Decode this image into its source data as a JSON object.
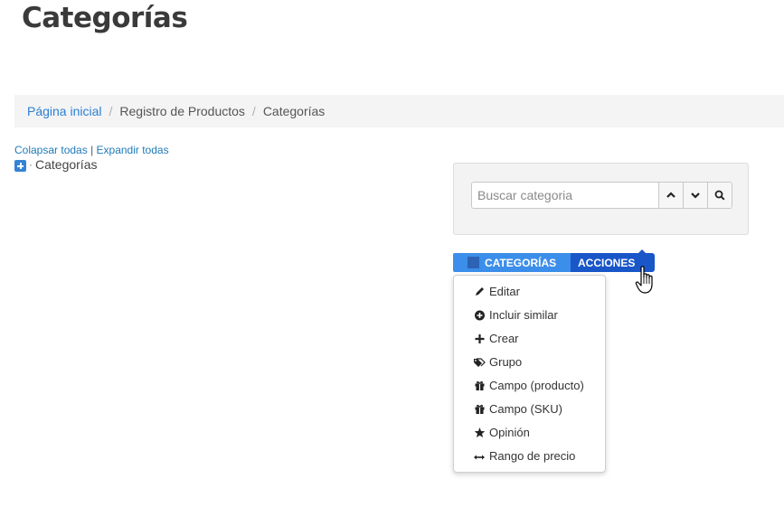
{
  "page": {
    "title": "Categorías"
  },
  "breadcrumb": {
    "home": "Página inicial",
    "separator": "/",
    "level1": "Registro de Productos",
    "current": "Categorías"
  },
  "tree": {
    "collapse_all": "Colapsar todas",
    "divider": "|",
    "expand_all": "Expandir todas",
    "root_label": "Categorías",
    "root_icon": "expand-plus-icon"
  },
  "search": {
    "placeholder": "Buscar categoria",
    "value": "",
    "prev_icon": "chevron-up-icon",
    "next_icon": "chevron-down-icon",
    "search_icon": "search-icon"
  },
  "tabs": {
    "categorias": "CATEGORÍAS",
    "acciones": "ACCIONES"
  },
  "actions_menu": {
    "items": [
      {
        "label": "Editar",
        "icon": "pencil-icon"
      },
      {
        "label": "Incluir similar",
        "icon": "plus-circle-icon"
      },
      {
        "label": "Crear",
        "icon": "plus-icon"
      },
      {
        "label": "Grupo",
        "icon": "tags-icon"
      },
      {
        "label": "Campo (producto)",
        "icon": "gift-icon"
      },
      {
        "label": "Campo (SKU)",
        "icon": "gift-icon"
      },
      {
        "label": "Opinión",
        "icon": "star-icon"
      },
      {
        "label": "Rango de precio",
        "icon": "arrows-horizontal-icon"
      }
    ]
  },
  "colors": {
    "link": "#2b7fd3",
    "tab_categorias": "#3b8eea",
    "tab_acciones": "#1956c8",
    "expand_icon": "#3583d4"
  }
}
